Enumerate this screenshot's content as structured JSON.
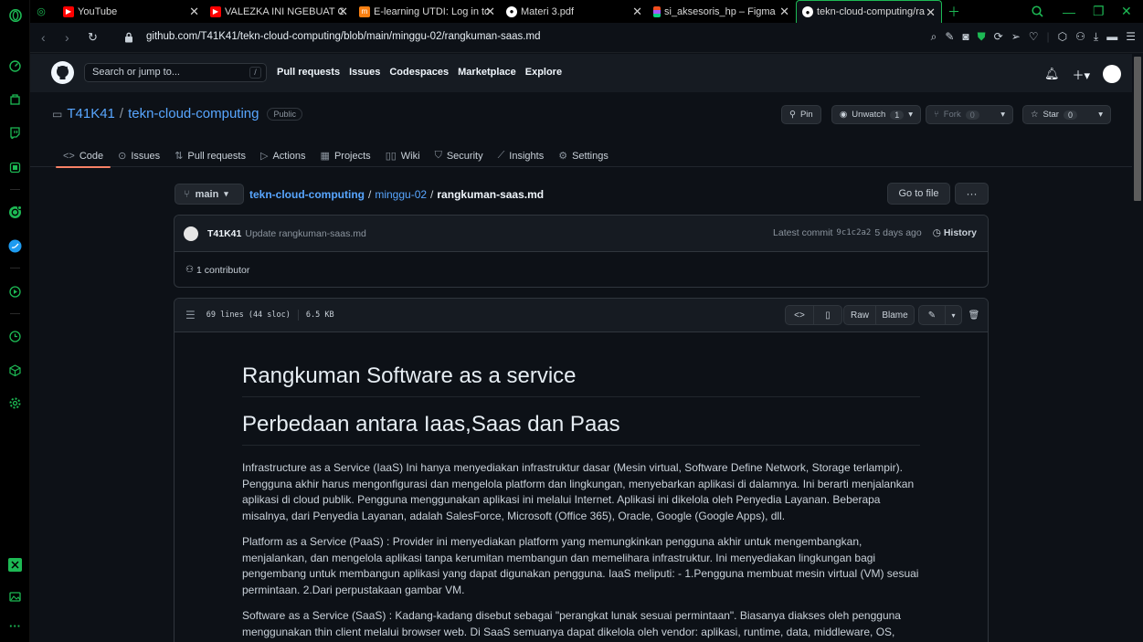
{
  "browser": {
    "tabs": [
      {
        "label": "YouTube",
        "favicon": "youtube-icon"
      },
      {
        "label": "VALEZKA INI NGEBUAT GW",
        "favicon": "youtube-icon"
      },
      {
        "label": "E-learning UTDI: Log in to",
        "favicon": "moodle-icon"
      },
      {
        "label": "Materi 3.pdf",
        "favicon": "globe-icon"
      },
      {
        "label": "si_aksesoris_hp – Figma",
        "favicon": "figma-icon"
      },
      {
        "label": "tekn-cloud-computing/ran",
        "favicon": "github-icon"
      }
    ],
    "url": "github.com/T41K41/tekn-cloud-computing/blob/main/minggu-02/rangkuman-saas.md",
    "accent": "#1db954"
  },
  "github": {
    "search_placeholder": "Search or jump to...",
    "search_key": "/",
    "nav": [
      "Pull requests",
      "Issues",
      "Codespaces",
      "Marketplace",
      "Explore"
    ]
  },
  "repo": {
    "owner": "T41K41",
    "name": "tekn-cloud-computing",
    "visibility": "Public",
    "pin": "Pin",
    "unwatch": "Unwatch",
    "watch_count": "1",
    "fork": "Fork",
    "fork_count": "0",
    "star": "Star",
    "star_count": "0",
    "tabs": [
      {
        "label": "Code",
        "icon": "code-icon"
      },
      {
        "label": "Issues",
        "icon": "issue-icon"
      },
      {
        "label": "Pull requests",
        "icon": "pull-request-icon"
      },
      {
        "label": "Actions",
        "icon": "play-icon"
      },
      {
        "label": "Projects",
        "icon": "table-icon"
      },
      {
        "label": "Wiki",
        "icon": "book-icon"
      },
      {
        "label": "Security",
        "icon": "shield-icon"
      },
      {
        "label": "Insights",
        "icon": "graph-icon"
      },
      {
        "label": "Settings",
        "icon": "gear-icon"
      }
    ]
  },
  "file": {
    "branch": "main",
    "crumb_repo": "tekn-cloud-computing",
    "crumb_dir": "minggu-02",
    "crumb_file": "rangkuman-saas.md",
    "go_to_file": "Go to file",
    "more": "···",
    "commit_user": "T41K41",
    "commit_msg": "Update rangkuman-saas.md",
    "latest_commit": "Latest commit",
    "commit_sha": "9c1c2a2",
    "commit_age": "5 days ago",
    "history": "History",
    "contributors": "1 contributor",
    "lines": "69 lines (44 sloc)",
    "size": "6.5 KB",
    "raw": "Raw",
    "blame": "Blame"
  },
  "markdown": {
    "h1a": "Rangkuman Software as a service",
    "h1b": "Perbedaan antara Iaas,Saas dan Paas",
    "p1": "Infrastructure as a Service (IaaS) Ini hanya menyediakan infrastruktur dasar (Mesin virtual, Software Define Network, Storage terlampir). Pengguna akhir harus mengonfigurasi dan mengelola platform dan lingkungan, menyebarkan aplikasi di dalamnya. Ini berarti menjalankan aplikasi di cloud publik. Pengguna menggunakan aplikasi ini melalui Internet. Aplikasi ini dikelola oleh Penyedia Layanan. Beberapa misalnya, dari Penyedia Layanan, adalah SalesForce, Microsoft (Office 365), Oracle, Google (Google Apps), dll.",
    "p2": "Platform as a Service (PaaS) : Provider ini menyediakan platform yang memungkinkan pengguna akhir untuk mengembangkan, menjalankan, dan mengelola aplikasi tanpa kerumitan membangun dan memelihara infrastruktur. Ini menyediakan lingkungan bagi pengembang untuk membangun aplikasi yang dapat digunakan pengguna. IaaS meliputi: - 1.Pengguna membuat mesin virtual (VM) sesuai permintaan. 2.Dari perpustakaan gambar VM.",
    "p3": "Software as a Service (SaaS) : Kadang-kadang disebut sebagai \"perangkat lunak sesuai permintaan\". Biasanya diakses oleh pengguna menggunakan thin client melalui browser web. Di SaaS semuanya dapat dikelola oleh vendor: aplikasi, runtime, data, middleware, OS,"
  }
}
